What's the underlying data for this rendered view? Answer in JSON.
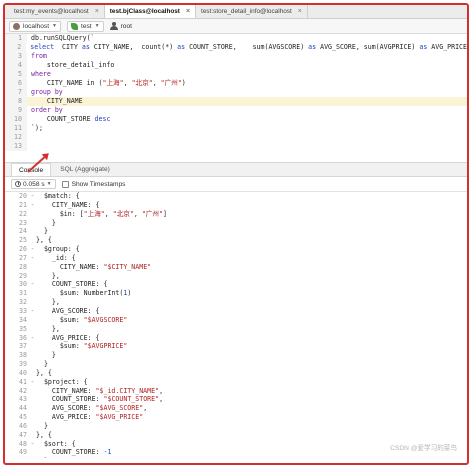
{
  "tabs": [
    {
      "label": "test:my_events@localhost",
      "active": false
    },
    {
      "label": "test.bjClass@localhost",
      "active": true
    },
    {
      "label": "test:store_detail_info@localhost",
      "active": false
    }
  ],
  "tab_close_glyph": "×",
  "path": {
    "connection": "localhost",
    "database": "test",
    "user": "root"
  },
  "editor": {
    "lines": [
      {
        "n": "1",
        "html": "db.runSQLQuery(`"
      },
      {
        "n": "2",
        "html": "<span class='k-blue'>select</span>  CITY <span class='k-blue'>as</span> CITY_NAME,  count(*) <span class='k-blue'>as</span> COUNT_STORE,    sum(AVGSCORE) <span class='k-blue'>as</span> AVG_SCORE, sum(AVGPRICE) <span class='k-blue'>as</span> AVG_PRICE"
      },
      {
        "n": "3",
        "html": "<span class='k-purple'>from</span>"
      },
      {
        "n": "4",
        "html": "    store_detail_info"
      },
      {
        "n": "5",
        "html": "<span class='k-purple'>where</span>"
      },
      {
        "n": "6",
        "html": "    CITY_NAME in (<span class='k-str'>\"上海\"</span>, <span class='k-str'>\"北京\"</span>, <span class='k-str'>\"广州\"</span>)"
      },
      {
        "n": "7",
        "html": "<span class='k-purple'>group by</span>"
      },
      {
        "n": "8",
        "html": "    CITY_NAME",
        "hl": true
      },
      {
        "n": "9",
        "html": "<span class='k-purple'>order by</span>"
      },
      {
        "n": "10",
        "html": "    COUNT_STORE <span class='k-blue'>desc</span>"
      },
      {
        "n": "11",
        "html": "`);"
      },
      {
        "n": "12",
        "html": ""
      },
      {
        "n": "13",
        "html": ""
      }
    ]
  },
  "panel_tabs": [
    {
      "label": "Console",
      "active": true
    },
    {
      "label": "SQL (Aggregate)",
      "active": false
    }
  ],
  "console_toolbar": {
    "time": "0.058 s",
    "show_timestamps_label": "Show Timestamps"
  },
  "console": {
    "lines": [
      {
        "n": "20",
        "fold": "-",
        "html": "  $match: {"
      },
      {
        "n": "21",
        "fold": "-",
        "html": "    CITY_NAME: {"
      },
      {
        "n": "22",
        "fold": "",
        "html": "      $in: [<span class='c-str'>\"上海\"</span>, <span class='c-str'>\"北京\"</span>, <span class='c-str'>\"广州\"</span>]"
      },
      {
        "n": "23",
        "fold": "",
        "html": "    }"
      },
      {
        "n": "24",
        "fold": "",
        "html": "  }"
      },
      {
        "n": "25",
        "fold": "",
        "html": "}, {"
      },
      {
        "n": "26",
        "fold": "-",
        "html": "  $group: {"
      },
      {
        "n": "27",
        "fold": "-",
        "html": "    _id: {"
      },
      {
        "n": "28",
        "fold": "",
        "html": "      CITY_NAME: <span class='c-str'>\"$CITY_NAME\"</span>"
      },
      {
        "n": "29",
        "fold": "",
        "html": "    },"
      },
      {
        "n": "30",
        "fold": "-",
        "html": "    COUNT_STORE: {"
      },
      {
        "n": "31",
        "fold": "",
        "html": "      $sum: NumberInt(<span class='c-num'>1</span>)"
      },
      {
        "n": "32",
        "fold": "",
        "html": "    },"
      },
      {
        "n": "33",
        "fold": "-",
        "html": "    AVG_SCORE: {"
      },
      {
        "n": "34",
        "fold": "",
        "html": "      $sum: <span class='c-str'>\"$AVGSCORE\"</span>"
      },
      {
        "n": "35",
        "fold": "",
        "html": "    },"
      },
      {
        "n": "36",
        "fold": "-",
        "html": "    AVG_PRICE: {"
      },
      {
        "n": "37",
        "fold": "",
        "html": "      $sum: <span class='c-str'>\"$AVGPRICE\"</span>"
      },
      {
        "n": "38",
        "fold": "",
        "html": "    }"
      },
      {
        "n": "39",
        "fold": "",
        "html": "  }"
      },
      {
        "n": "40",
        "fold": "",
        "html": "}, {"
      },
      {
        "n": "41",
        "fold": "-",
        "html": "  $project: {"
      },
      {
        "n": "42",
        "fold": "",
        "html": "    CITY_NAME: <span class='c-str'>\"$_id.CITY_NAME\"</span>,"
      },
      {
        "n": "43",
        "fold": "",
        "html": "    COUNT_STORE: <span class='c-str'>\"$COUNT_STORE\"</span>,"
      },
      {
        "n": "44",
        "fold": "",
        "html": "    AVG_SCORE: <span class='c-str'>\"$AVG_SCORE\"</span>,"
      },
      {
        "n": "45",
        "fold": "",
        "html": "    AVG_PRICE: <span class='c-str'>\"$AVG_PRICE\"</span>"
      },
      {
        "n": "46",
        "fold": "",
        "html": "  }"
      },
      {
        "n": "47",
        "fold": "",
        "html": "}, {"
      },
      {
        "n": "48",
        "fold": "-",
        "html": "  $sort: {"
      },
      {
        "n": "49",
        "fold": "",
        "html": "    COUNT_STORE: <span class='c-num'>-1</span>"
      },
      {
        "n": "50",
        "fold": "",
        "html": "  }"
      },
      {
        "n": "51",
        "fold": "",
        "html": "}])"
      }
    ]
  },
  "watermark": "CSDN @爱学习的菜鸟"
}
